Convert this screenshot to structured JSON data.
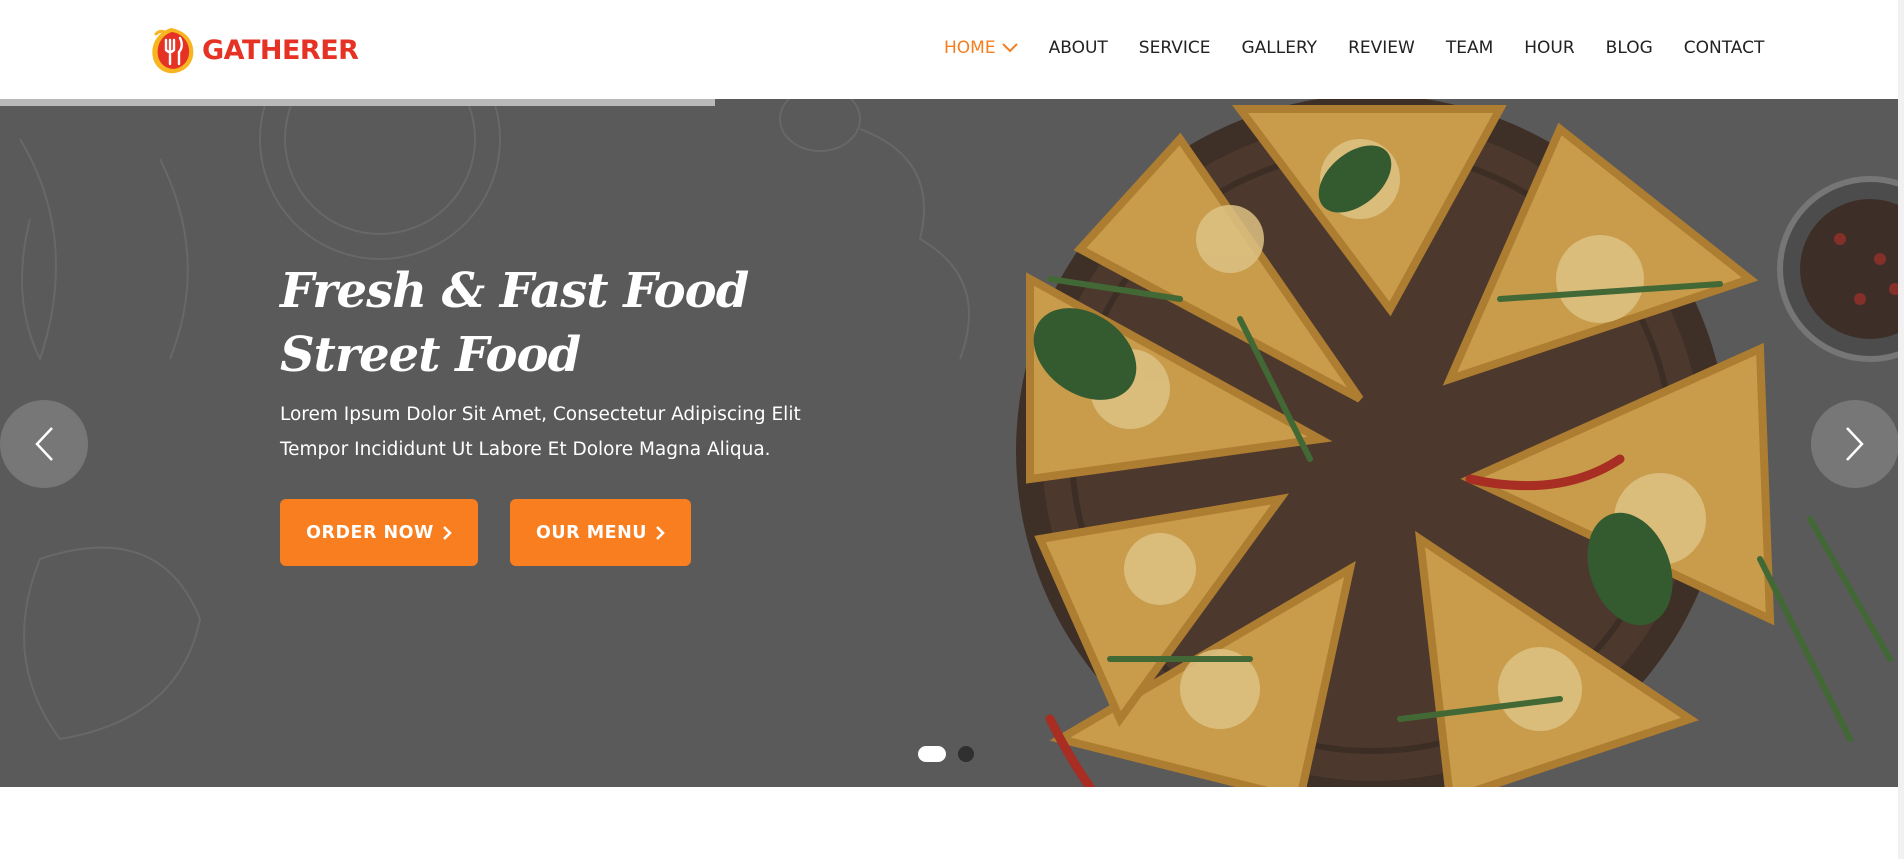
{
  "brand": {
    "name": "GATHERER",
    "logo_icon": "fork-and-knife-flame-logo",
    "color": "#e53224"
  },
  "nav": {
    "items": [
      {
        "label": "HOME",
        "active": true,
        "has_dropdown": true
      },
      {
        "label": "ABOUT"
      },
      {
        "label": "SERVICE"
      },
      {
        "label": "GALLERY"
      },
      {
        "label": "REVIEW"
      },
      {
        "label": "TEAM"
      },
      {
        "label": "HOUR"
      },
      {
        "label": "BLOG"
      },
      {
        "label": "CONTACT"
      }
    ],
    "active_color": "#f57f20"
  },
  "hero": {
    "title_line1": "Fresh & Fast Food",
    "title_line2": "Street Food",
    "desc_line1": "Lorem Ipsum Dolor Sit Amet, Consectetur Adipiscing Elit",
    "desc_line2": "Tempor Incididunt Ut Labore Et Dolore Magna Aliqua.",
    "order_label": "ORDER NOW",
    "menu_label": "OUR MENU",
    "accent": "#f97e1f",
    "prev_icon": "chevron-left-icon",
    "next_icon": "chevron-right-icon",
    "slides": 2,
    "current_slide": 1
  }
}
